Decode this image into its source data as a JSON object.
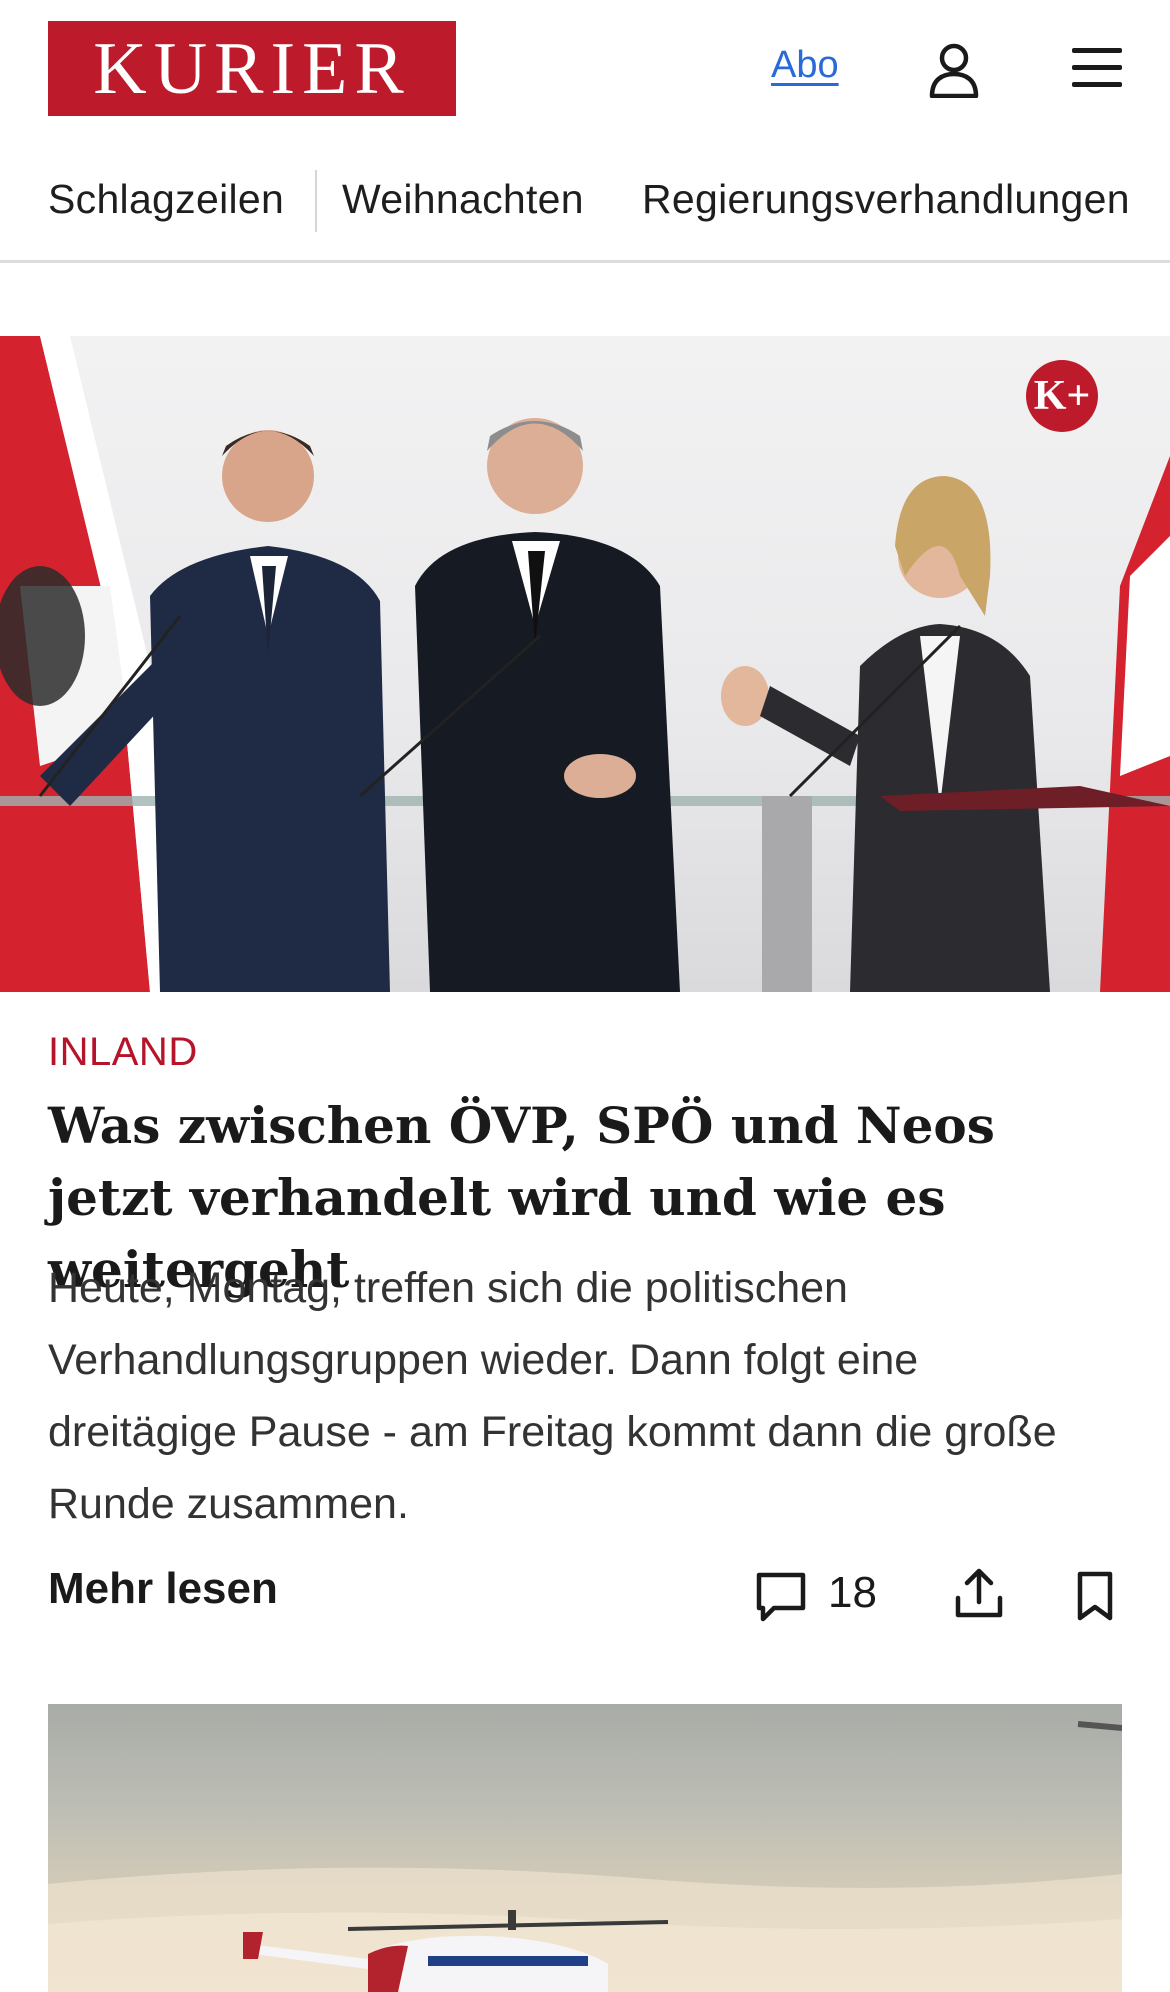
{
  "header": {
    "logo_text": "KURIER",
    "abo_link": "Abo",
    "user_icon": "user-icon",
    "menu_icon": "hamburger-menu-icon"
  },
  "nav": {
    "items": [
      {
        "label": "Schlagzeilen"
      },
      {
        "label": "Weihnachten"
      },
      {
        "label": "Regierungsverhandlungen"
      }
    ]
  },
  "article": {
    "premium_badge": "K+",
    "category": "INLAND",
    "headline": "Was zwischen ÖVP, SPÖ und Neos jetzt verhandelt wird und wie es weitergeht",
    "teaser": "Heute, Montag, treffen sich die politischen Verhandlungsgruppen wieder. Dann folgt eine dreitägige Pause - am Freitag kommt dann die große Runde zusammen.",
    "more_label": "Mehr lesen",
    "comment_count": "18"
  },
  "colors": {
    "brand_red": "#bd1b2c",
    "category_red": "#b5142b",
    "link_blue": "#2a6ad6"
  }
}
